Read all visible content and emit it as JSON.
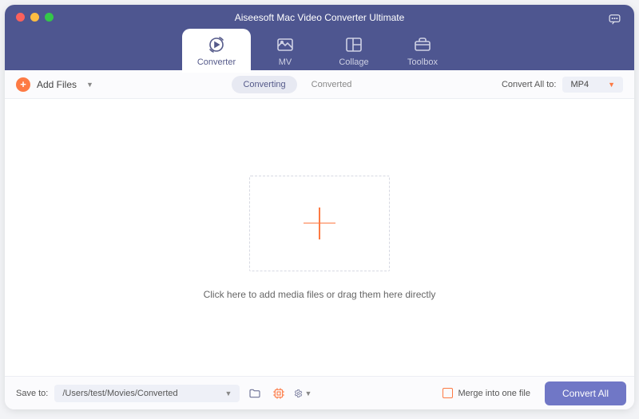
{
  "header": {
    "title": "Aiseesoft Mac Video Converter Ultimate",
    "tabs": [
      {
        "label": "Converter"
      },
      {
        "label": "MV"
      },
      {
        "label": "Collage"
      },
      {
        "label": "Toolbox"
      }
    ]
  },
  "toolbar": {
    "add_files_label": "Add Files",
    "segments": {
      "converting": "Converting",
      "converted": "Converted"
    },
    "convert_all_to_label": "Convert All to:",
    "format_selected": "MP4"
  },
  "stage": {
    "hint": "Click here to add media files or drag them here directly"
  },
  "footer": {
    "save_to_label": "Save to:",
    "save_path": "/Users/test/Movies/Converted",
    "merge_label": "Merge into one file",
    "convert_all_label": "Convert All"
  }
}
